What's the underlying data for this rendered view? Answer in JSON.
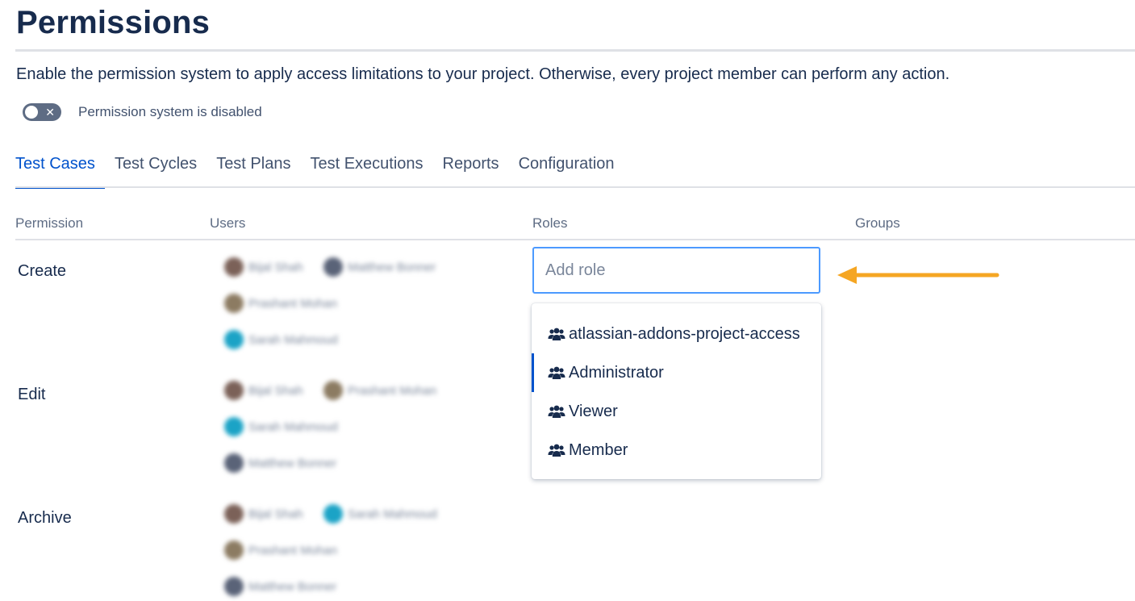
{
  "page": {
    "title": "Permissions",
    "description": "Enable the permission system to apply access limitations to your project. Otherwise, every project member can perform any action."
  },
  "toggle": {
    "state": "off",
    "icon": "x-icon",
    "label": "Permission system is disabled"
  },
  "tabs": [
    {
      "label": "Test Cases",
      "active": true
    },
    {
      "label": "Test Cycles",
      "active": false
    },
    {
      "label": "Test Plans",
      "active": false
    },
    {
      "label": "Test Executions",
      "active": false
    },
    {
      "label": "Reports",
      "active": false
    },
    {
      "label": "Configuration",
      "active": false
    }
  ],
  "columns": {
    "permission": "Permission",
    "users": "Users",
    "roles": "Roles",
    "groups": "Groups"
  },
  "permissions": [
    {
      "name": "Create",
      "users": [
        "Bijal Shah",
        "Matthew Bonner",
        "Prashant Mohan",
        "Sarah Mahmoud"
      ]
    },
    {
      "name": "Edit",
      "users": [
        "Bijal Shah",
        "Prashant Mohan",
        "Sarah Mahmoud",
        "Matthew Bonner"
      ]
    },
    {
      "name": "Archive",
      "users": [
        "Bijal Shah",
        "Sarah Mahmoud",
        "Prashant Mohan",
        "Matthew Bonner"
      ]
    }
  ],
  "role_input": {
    "placeholder": "Add role",
    "value": ""
  },
  "role_dropdown": {
    "icon": "users-group-icon",
    "options": [
      {
        "label": "atlassian-addons-project-access",
        "selected": false
      },
      {
        "label": "Administrator",
        "selected": true
      },
      {
        "label": "Viewer",
        "selected": false
      },
      {
        "label": "Member",
        "selected": false
      }
    ]
  },
  "colors": {
    "accent": "#0052cc",
    "focus_border": "#4c9aff",
    "annotation_arrow": "#f5a623",
    "toggle_off": "#5e6c84",
    "avatar_brown": "#7b6158",
    "avatar_teal": "#1ba3c6",
    "avatar_olive": "#8c7b62",
    "avatar_slate": "#5a6378"
  }
}
